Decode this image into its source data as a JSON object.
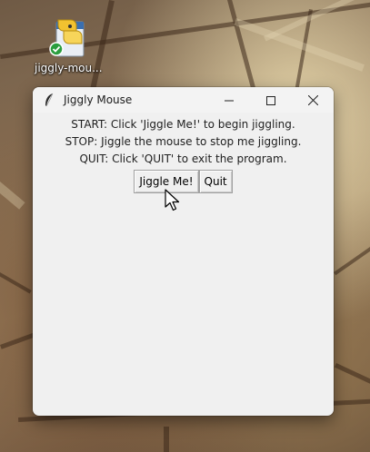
{
  "desktop": {
    "icon": {
      "label": "jiggly-mou...",
      "name": "python-file-icon"
    }
  },
  "window": {
    "title": "Jiggly Mouse",
    "app_icon": "feather-icon",
    "controls": {
      "minimize": "minimize-icon",
      "maximize": "maximize-icon",
      "close": "close-icon"
    }
  },
  "instructions": [
    "START: Click 'Jiggle Me!' to begin jiggling.",
    "STOP: Jiggle the mouse to stop me jiggling.",
    "QUIT: Click 'QUIT' to exit the program."
  ],
  "buttons": {
    "jiggle_label": "Jiggle Me!",
    "quit_label": "Quit"
  },
  "colors": {
    "window_bg": "#f0f0f0",
    "text": "#1e1e1e"
  }
}
